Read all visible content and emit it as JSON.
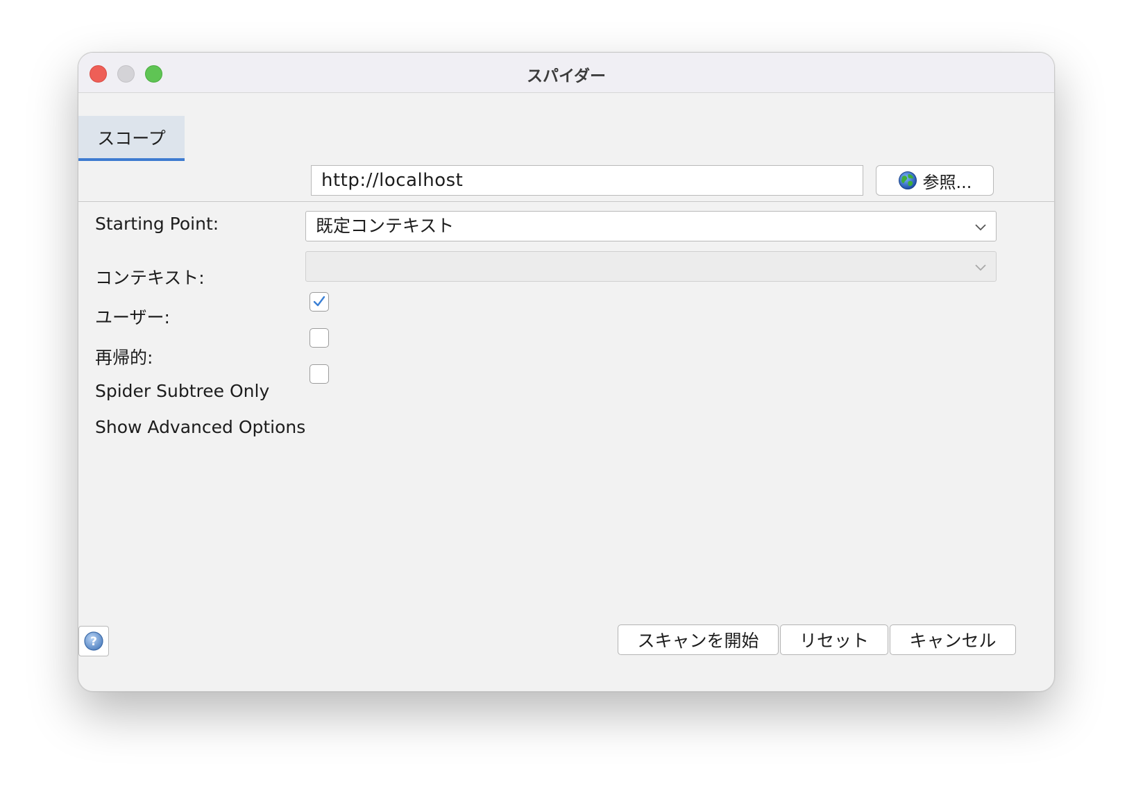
{
  "window": {
    "title": "スパイダー"
  },
  "tabs": [
    {
      "label": "スコープ",
      "selected": true
    }
  ],
  "form": {
    "starting_point": {
      "label": "Starting Point:",
      "value": "http://localhost",
      "browse_label": "参照..."
    },
    "context": {
      "label": "コンテキスト:",
      "value": "既定コンテキスト"
    },
    "user": {
      "label": "ユーザー:",
      "value": ""
    },
    "recursive": {
      "label": "再帰的:",
      "checked": true
    },
    "subtree_only": {
      "label": "Spider Subtree Only",
      "checked": false
    },
    "advanced": {
      "label": "Show Advanced Options",
      "checked": false
    }
  },
  "buttons": {
    "start": "スキャンを開始",
    "reset": "リセット",
    "cancel": "キャンセル"
  },
  "colors": {
    "tab_accent": "#3e7bd0",
    "check_mark": "#3a7fd5",
    "close": "#ee5f57",
    "maximize": "#5fc454"
  }
}
